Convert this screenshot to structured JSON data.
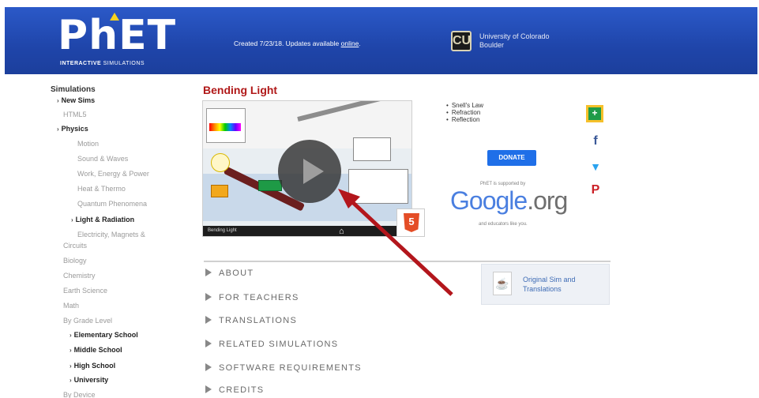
{
  "header": {
    "logo_text": "PhET",
    "logo_sub_bold": "INTERACTIVE",
    "logo_sub": "SIMULATIONS",
    "created_text": "Created 7/23/18. Updates available",
    "created_link": "online",
    "university_line1": "University of Colorado",
    "university_line2": "Boulder"
  },
  "sidebar": {
    "title": "Simulations",
    "items": [
      {
        "label": "New Sims",
        "bold": true
      },
      {
        "label": "HTML5",
        "bold": false
      },
      {
        "label": "Physics",
        "bold": true
      },
      {
        "label": "Motion",
        "bold": false
      },
      {
        "label": "Sound & Waves",
        "bold": false
      },
      {
        "label": "Work, Energy & Power",
        "bold": false
      },
      {
        "label": "Heat & Thermo",
        "bold": false
      },
      {
        "label": "Quantum Phenomena",
        "bold": false
      },
      {
        "label": "Light & Radiation",
        "bold": true
      },
      {
        "label": "Electricity, Magnets &",
        "bold": false
      },
      {
        "label": "Circuits",
        "bold": false
      },
      {
        "label": "Biology",
        "bold": false
      },
      {
        "label": "Chemistry",
        "bold": false
      },
      {
        "label": "Earth Science",
        "bold": false
      },
      {
        "label": "Math",
        "bold": false
      },
      {
        "label": "By Grade Level",
        "bold": false
      },
      {
        "label": "Elementary School",
        "bold": true
      },
      {
        "label": "Middle School",
        "bold": true
      },
      {
        "label": "High School",
        "bold": true
      },
      {
        "label": "University",
        "bold": true
      },
      {
        "label": "By Device",
        "bold": false
      }
    ]
  },
  "sim": {
    "title": "Bending Light",
    "bar_label": "Bending Light",
    "html5_badge": "5"
  },
  "topics": [
    "Snell's Law",
    "Refraction",
    "Reflection"
  ],
  "donate_label": "DONATE",
  "supported_by": "PhET is supported by",
  "google": {
    "word": "Google",
    "suffix": ".org"
  },
  "and_donors": "and educators like you.",
  "social": {
    "facebook": "f",
    "twitter": "🐦",
    "pinterest": "P"
  },
  "sections": [
    "ABOUT",
    "FOR TEACHERS",
    "TRANSLATIONS",
    "RELATED SIMULATIONS",
    "SOFTWARE REQUIREMENTS",
    "CREDITS"
  ],
  "original_sim": {
    "line1": "Original Sim and",
    "line2": "Translations"
  },
  "colors": {
    "header": "#2150b8",
    "title": "#b01818",
    "arrow": "#b3161c",
    "link": "#3d6bb5"
  }
}
